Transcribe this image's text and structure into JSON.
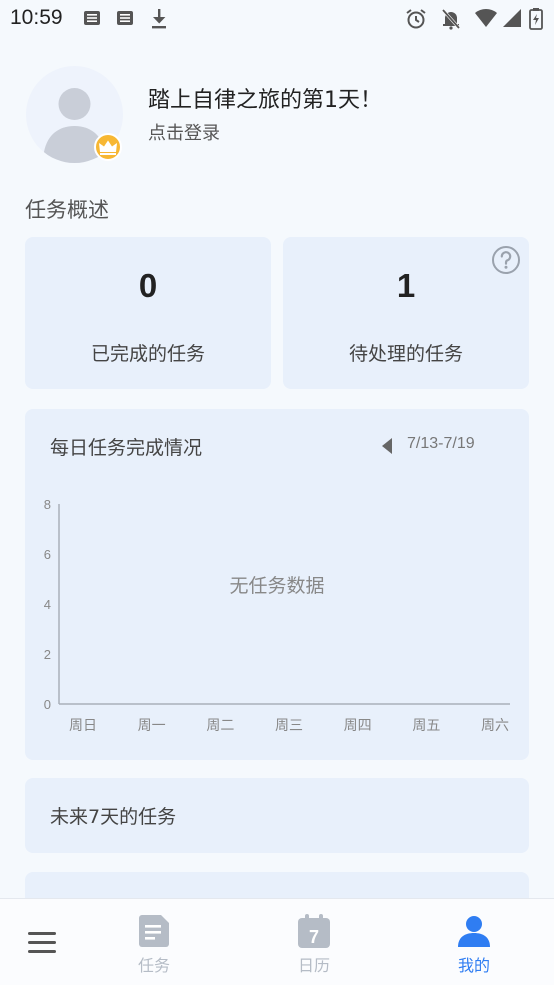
{
  "status_bar": {
    "time": "10:59",
    "left_icons": [
      "sim-card-icon",
      "sim-card-icon",
      "download-icon"
    ],
    "right_icons": [
      "alarm-icon",
      "notifications-off-icon",
      "wifi-icon",
      "signal-icon",
      "battery-icon"
    ]
  },
  "profile": {
    "greeting": "踏上自律之旅的第1天！",
    "login_prompt": "点击登录",
    "avatar_icon": "person-placeholder-icon",
    "badge_icon": "crown-icon"
  },
  "overview": {
    "title": "任务概述",
    "completed": {
      "value": "0",
      "label": "已完成的任务"
    },
    "pending": {
      "value": "1",
      "label": "待处理的任务",
      "help_icon": "question-circle-icon"
    }
  },
  "daily_chart": {
    "title": "每日任务完成情况",
    "week_range": "7/13-7/19",
    "prev_icon": "caret-left-icon",
    "empty_text": "无任务数据"
  },
  "chart_data": {
    "type": "line",
    "title": "每日任务完成情况",
    "categories": [
      "周日",
      "周一",
      "周二",
      "周三",
      "周四",
      "周五",
      "周六"
    ],
    "y_ticks": [
      0,
      2,
      4,
      6,
      8
    ],
    "ylim": [
      0,
      8
    ],
    "series": [],
    "annotations": [
      "无任务数据"
    ],
    "grid": false
  },
  "upcoming": {
    "title": "未来7天的任务"
  },
  "bottom_nav": {
    "menu_icon": "hamburger-menu-icon",
    "items": [
      {
        "label": "任务",
        "icon": "task-list-icon",
        "active": false
      },
      {
        "label": "日历",
        "icon": "calendar-icon",
        "calendar_day": "7",
        "active": false
      },
      {
        "label": "我的",
        "icon": "person-icon",
        "active": true
      }
    ]
  },
  "colors": {
    "accent": "#2f7df2",
    "inactive": "#b5bcc6",
    "card_bg": "#e8f0fb",
    "page_bg": "#f5f9fd",
    "badge": "#f7b733"
  }
}
